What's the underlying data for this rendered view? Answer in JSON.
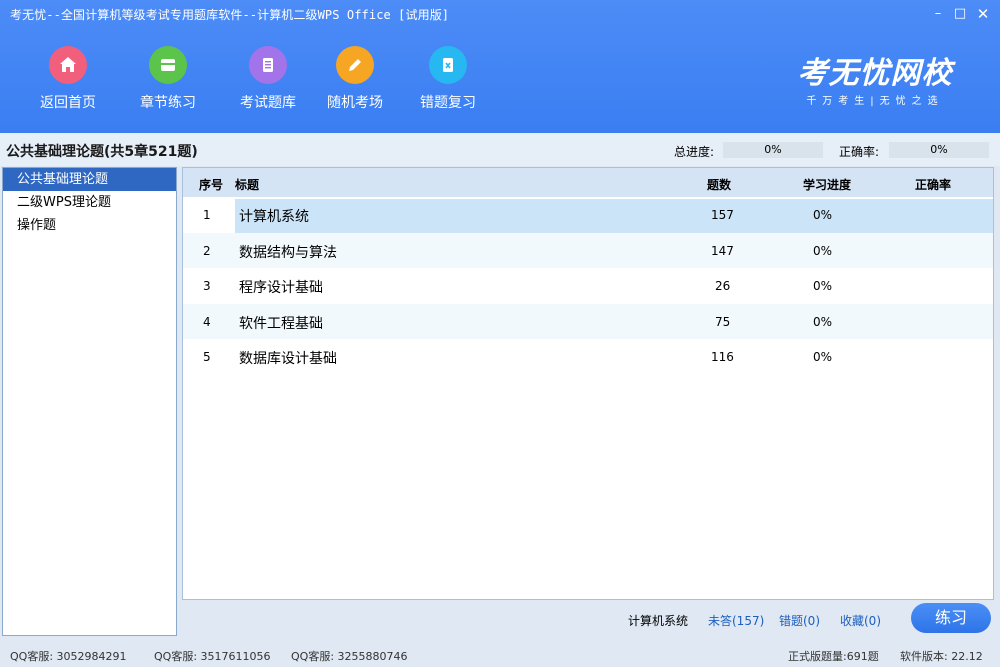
{
  "window": {
    "title": "考无忧--全国计算机等级考试专用题库软件--计算机二级WPS Office [试用版]",
    "min": "–",
    "max": "□",
    "close": "✕"
  },
  "nav": [
    {
      "label": "返回首页",
      "icon": "home-icon",
      "color": "#f15f7c"
    },
    {
      "label": "章节练习",
      "icon": "chapter-icon",
      "color": "#5cc44a"
    },
    {
      "label": "考试题库",
      "icon": "document-icon",
      "color": "#a373ea"
    },
    {
      "label": "随机考场",
      "icon": "pencil-icon",
      "color": "#f6a623"
    },
    {
      "label": "错题复习",
      "icon": "error-review-icon",
      "color": "#27b7f1"
    }
  ],
  "logo": {
    "main": "考无忧网校",
    "sub": "千万考生|无忧之选"
  },
  "subheader": {
    "title": "公共基础理论题(共5章521题)",
    "progress_label": "总进度:",
    "progress_value": "0%",
    "accuracy_label": "正确率:",
    "accuracy_value": "0%"
  },
  "sidebar": [
    {
      "label": "公共基础理论题",
      "active": true
    },
    {
      "label": "二级WPS理论题",
      "active": false
    },
    {
      "label": "操作题",
      "active": false
    }
  ],
  "table": {
    "headers": {
      "index": "序号",
      "title": "标题",
      "count": "题数",
      "progress": "学习进度",
      "accuracy": "正确率"
    },
    "rows": [
      {
        "index": "1",
        "title": "计算机系统",
        "count": "157",
        "progress": "0%",
        "accuracy": ""
      },
      {
        "index": "2",
        "title": "数据结构与算法",
        "count": "147",
        "progress": "0%",
        "accuracy": ""
      },
      {
        "index": "3",
        "title": "程序设计基础",
        "count": "26",
        "progress": "0%",
        "accuracy": ""
      },
      {
        "index": "4",
        "title": "软件工程基础",
        "count": "75",
        "progress": "0%",
        "accuracy": ""
      },
      {
        "index": "5",
        "title": "数据库设计基础",
        "count": "116",
        "progress": "0%",
        "accuracy": ""
      }
    ]
  },
  "footer": {
    "chapter": "计算机系统",
    "unanswered": "未答(157)",
    "wrong": "错题(0)",
    "favorites": "收藏(0)",
    "practice": "练习"
  },
  "status": {
    "qq1": "QQ客服: 3052984291",
    "qq2": "QQ客服: 3517611056",
    "qq3": "QQ客服: 3255880746",
    "total": "正式版题量:691题",
    "version": "软件版本: 22.12"
  },
  "colors": {
    "header_blue": "#3a7ef2",
    "active_blue": "#2f68c3",
    "link_blue": "#1d5fbf"
  }
}
